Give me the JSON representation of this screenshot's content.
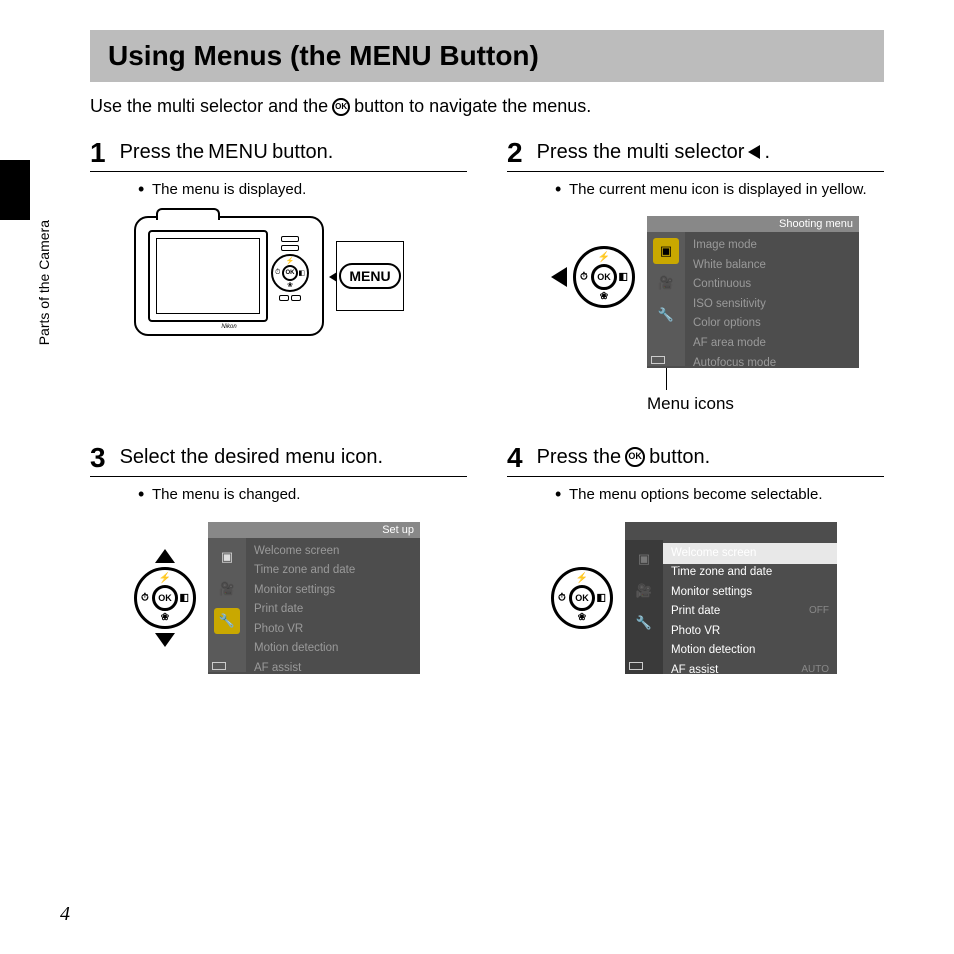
{
  "page": {
    "number": "4",
    "section": "Parts of the Camera"
  },
  "title": {
    "before": "Using Menus (the ",
    "menu_word": "MENU",
    "after": " Button)"
  },
  "intro": {
    "before": "Use the multi selector and the ",
    "ok_label": "OK",
    "after": " button to navigate the menus."
  },
  "steps": {
    "s1": {
      "num": "1",
      "title_before": "Press the ",
      "title_menu": "MENU",
      "title_after": " button.",
      "bullet": "The menu is displayed.",
      "callout_label": "MENU",
      "selector_ok": "OK"
    },
    "s2": {
      "num": "2",
      "title_before": "Press the multi selector ",
      "title_after": ".",
      "bullet": "The current menu icon is displayed in yellow.",
      "selector_ok": "OK",
      "caption": "Menu icons",
      "lcd": {
        "header": "Shooting menu",
        "items": [
          "Image mode",
          "White balance",
          "Continuous",
          "ISO sensitivity",
          "Color options",
          "AF area mode",
          "Autofocus mode"
        ]
      }
    },
    "s3": {
      "num": "3",
      "title": "Select the desired menu icon.",
      "bullet": "The menu is changed.",
      "selector_ok": "OK",
      "lcd": {
        "header": "Set up",
        "items": [
          "Welcome screen",
          "Time zone and date",
          "Monitor settings",
          "Print date",
          "Photo VR",
          "Motion detection",
          "AF assist"
        ]
      }
    },
    "s4": {
      "num": "4",
      "title_before": "Press the ",
      "ok_label": "OK",
      "title_after": " button.",
      "bullet": "The menu options become selectable.",
      "selector_ok": "OK",
      "lcd": {
        "items": [
          {
            "label": "Welcome screen",
            "hi": true
          },
          {
            "label": "Time zone and date"
          },
          {
            "label": "Monitor settings"
          },
          {
            "label": "Print date",
            "val": "OFF"
          },
          {
            "label": "Photo VR"
          },
          {
            "label": "Motion detection"
          },
          {
            "label": "AF assist",
            "val": "AUTO"
          }
        ]
      }
    }
  }
}
